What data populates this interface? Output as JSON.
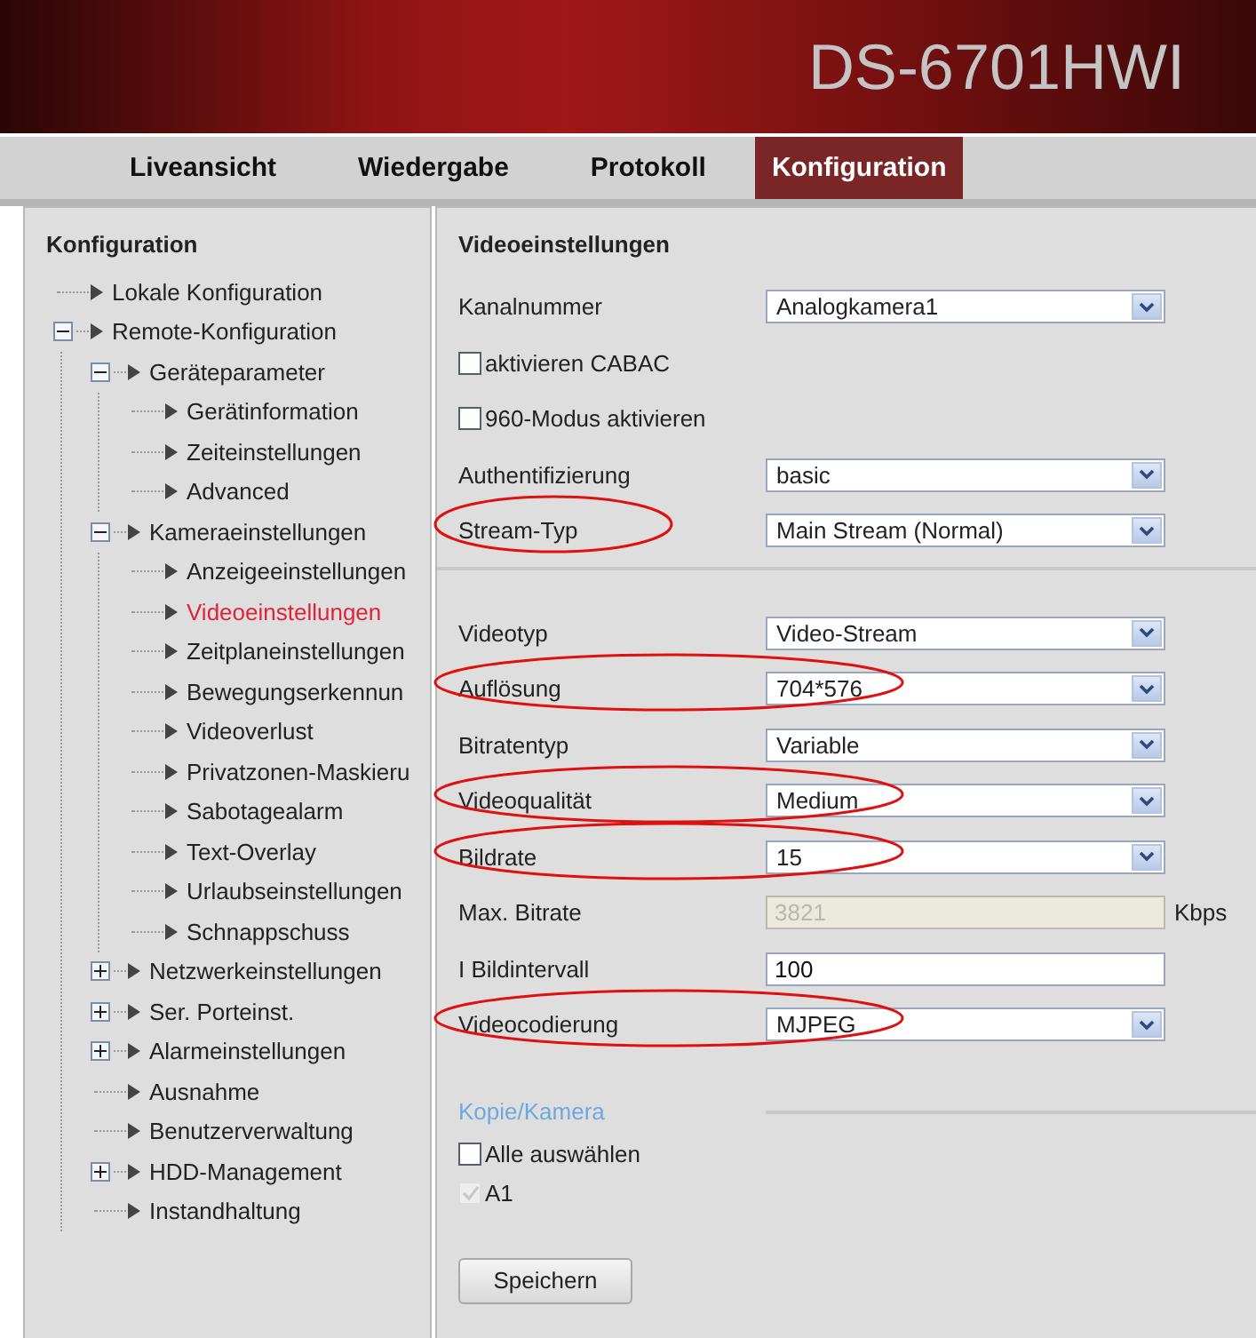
{
  "header": {
    "title": "DS-6701HWI"
  },
  "tabs": [
    {
      "label": "Liveansicht",
      "selected": false
    },
    {
      "label": "Wiedergabe",
      "selected": false
    },
    {
      "label": "Protokoll",
      "selected": false
    },
    {
      "label": "Konfiguration",
      "selected": true
    }
  ],
  "sidebar": {
    "title": "Konfiguration",
    "tree": [
      {
        "kind": "leaf",
        "label": "Lokale Konfiguration",
        "selected": false
      },
      {
        "kind": "node",
        "label": "Remote-Konfiguration",
        "expanded": true,
        "selected": false,
        "children": [
          {
            "kind": "node",
            "label": "Geräteparameter",
            "expanded": true,
            "selected": false,
            "children": [
              {
                "kind": "leaf",
                "label": "Gerätinformation",
                "selected": false
              },
              {
                "kind": "leaf",
                "label": "Zeiteinstellungen",
                "selected": false
              },
              {
                "kind": "leaf",
                "label": "Advanced",
                "selected": false
              }
            ]
          },
          {
            "kind": "node",
            "label": "Kameraeinstellungen",
            "expanded": true,
            "selected": false,
            "children": [
              {
                "kind": "leaf",
                "label": "Anzeigeeinstellungen",
                "selected": false
              },
              {
                "kind": "leaf",
                "label": "Videoeinstellungen",
                "selected": true
              },
              {
                "kind": "leaf",
                "label": "Zeitplaneinstellungen",
                "selected": false
              },
              {
                "kind": "leaf",
                "label": "Bewegungserkennun",
                "selected": false
              },
              {
                "kind": "leaf",
                "label": "Videoverlust",
                "selected": false
              },
              {
                "kind": "leaf",
                "label": "Privatzonen-Maskieru",
                "selected": false
              },
              {
                "kind": "leaf",
                "label": "Sabotagealarm",
                "selected": false
              },
              {
                "kind": "leaf",
                "label": "Text-Overlay",
                "selected": false
              },
              {
                "kind": "leaf",
                "label": "Urlaubseinstellungen",
                "selected": false
              },
              {
                "kind": "leaf",
                "label": "Schnappschuss",
                "selected": false
              }
            ]
          },
          {
            "kind": "node",
            "label": "Netzwerkeinstellungen",
            "expanded": false,
            "selected": false
          },
          {
            "kind": "node",
            "label": "Ser. Porteinst.",
            "expanded": false,
            "selected": false
          },
          {
            "kind": "node",
            "label": "Alarmeinstellungen",
            "expanded": false,
            "selected": false
          },
          {
            "kind": "leaf",
            "label": "Ausnahme",
            "selected": false
          },
          {
            "kind": "leaf",
            "label": "Benutzerverwaltung",
            "selected": false
          },
          {
            "kind": "node",
            "label": "HDD-Management",
            "expanded": false,
            "selected": false
          },
          {
            "kind": "leaf",
            "label": "Instandhaltung",
            "selected": false
          }
        ]
      }
    ]
  },
  "settings": {
    "title": "Videoeinstellungen",
    "sections": [
      {
        "rows": [
          {
            "kind": "select",
            "label": "Kanalnummer",
            "value": "Analogkamera1",
            "label_circled": false,
            "value_circled": false
          },
          {
            "kind": "checkbox",
            "label": "aktivieren CABAC",
            "checked": false
          },
          {
            "kind": "checkbox",
            "label": "960-Modus aktivieren",
            "checked": false
          },
          {
            "kind": "select",
            "label": "Authentifizierung",
            "value": "basic",
            "label_circled": false,
            "value_circled": false
          },
          {
            "kind": "select",
            "label": "Stream-Typ",
            "value": "Main Stream (Normal)",
            "label_circled": true,
            "value_circled": false
          }
        ]
      },
      {
        "rows": [
          {
            "kind": "select",
            "label": "Videotyp",
            "value": "Video-Stream",
            "label_circled": false,
            "value_circled": false
          },
          {
            "kind": "select",
            "label": "Auflösung",
            "value": "704*576",
            "label_circled": true,
            "value_circled": true
          },
          {
            "kind": "select",
            "label": "Bitratentyp",
            "value": "Variable",
            "label_circled": false,
            "value_circled": false
          },
          {
            "kind": "select",
            "label": "Videoqualität",
            "value": "Medium",
            "label_circled": true,
            "value_circled": true
          },
          {
            "kind": "select",
            "label": "Bildrate",
            "value": "15",
            "label_circled": true,
            "value_circled": true
          },
          {
            "kind": "input",
            "label": "Max. Bitrate",
            "value": "3821",
            "disabled": true,
            "unit": "Kbps",
            "label_circled": false,
            "value_circled": false
          },
          {
            "kind": "input",
            "label": "I Bildintervall",
            "value": "100",
            "disabled": false,
            "label_circled": false,
            "value_circled": false
          },
          {
            "kind": "select",
            "label": "Videocodierung",
            "value": "MJPEG",
            "label_circled": true,
            "value_circled": true
          }
        ]
      }
    ],
    "copy": {
      "title": "Kopie/Kamera",
      "items": [
        {
          "label": "Alle auswählen",
          "checked": false,
          "disabled": false
        },
        {
          "label": "A1",
          "checked": true,
          "disabled": true
        }
      ]
    },
    "save_button": "Speichern"
  }
}
